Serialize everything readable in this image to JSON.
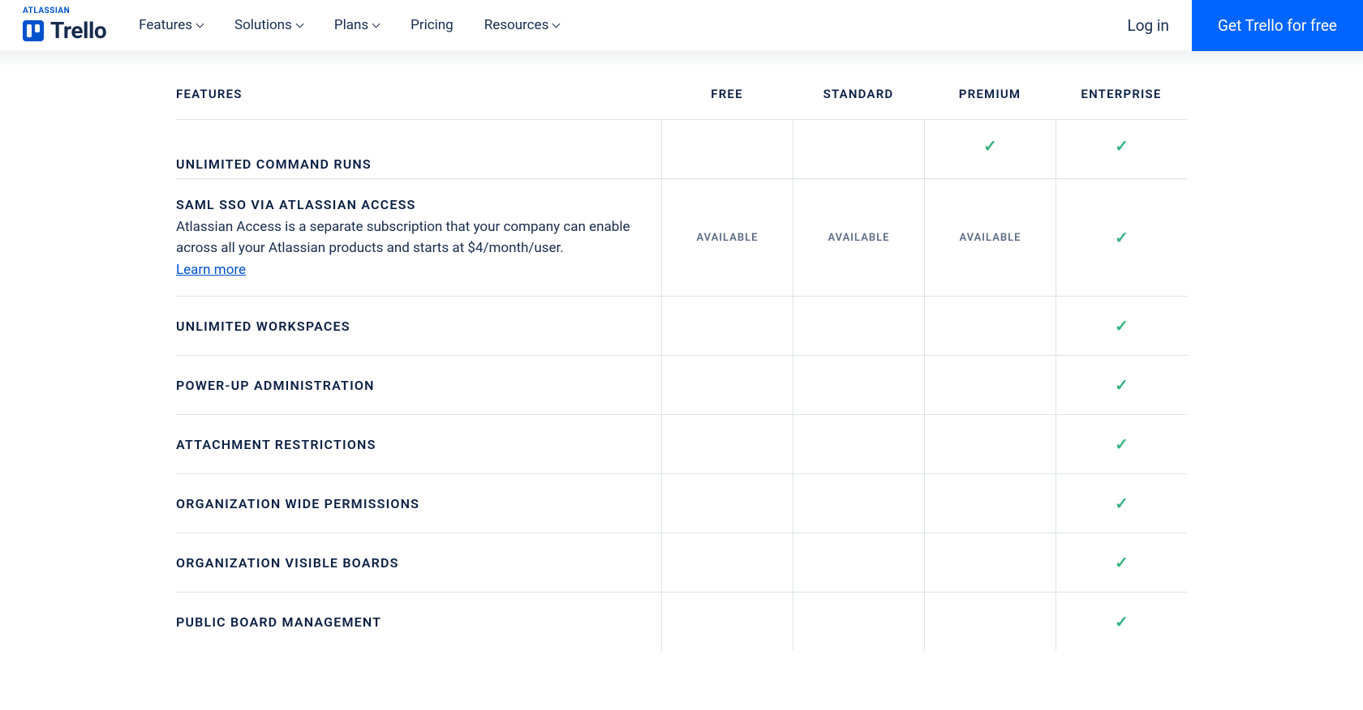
{
  "brand": {
    "parent": "ATLASSIAN",
    "name": "Trello"
  },
  "nav": {
    "features": "Features",
    "solutions": "Solutions",
    "plans": "Plans",
    "pricing": "Pricing",
    "resources": "Resources"
  },
  "auth": {
    "login": "Log in",
    "cta": "Get Trello for free"
  },
  "columns": {
    "features": "FEATURES",
    "free": "FREE",
    "standard": "STANDARD",
    "premium": "PREMIUM",
    "enterprise": "ENTERPRISE"
  },
  "available": "AVAILABLE",
  "learn_more": "Learn more",
  "rows": [
    {
      "title": "UNLIMITED COMMAND RUNS",
      "desc": "",
      "link": false,
      "cells": [
        "",
        "",
        "check",
        "check"
      ],
      "cut": true
    },
    {
      "title": "SAML SSO VIA ATLASSIAN ACCESS",
      "desc": "Atlassian Access is a separate subscription that your company can enable across all your Atlassian products and starts at $4/month/user.",
      "link": true,
      "cells": [
        "avail",
        "avail",
        "avail",
        "check"
      ]
    },
    {
      "title": "UNLIMITED WORKSPACES",
      "desc": "",
      "link": false,
      "cells": [
        "",
        "",
        "",
        "check"
      ]
    },
    {
      "title": "POWER-UP ADMINISTRATION",
      "desc": "",
      "link": false,
      "cells": [
        "",
        "",
        "",
        "check"
      ]
    },
    {
      "title": "ATTACHMENT RESTRICTIONS",
      "desc": "",
      "link": false,
      "cells": [
        "",
        "",
        "",
        "check"
      ]
    },
    {
      "title": "ORGANIZATION WIDE PERMISSIONS",
      "desc": "",
      "link": false,
      "cells": [
        "",
        "",
        "",
        "check"
      ]
    },
    {
      "title": "ORGANIZATION VISIBLE BOARDS",
      "desc": "",
      "link": false,
      "cells": [
        "",
        "",
        "",
        "check"
      ]
    },
    {
      "title": "PUBLIC BOARD MANAGEMENT",
      "desc": "",
      "link": false,
      "cells": [
        "",
        "",
        "",
        "check"
      ]
    }
  ]
}
